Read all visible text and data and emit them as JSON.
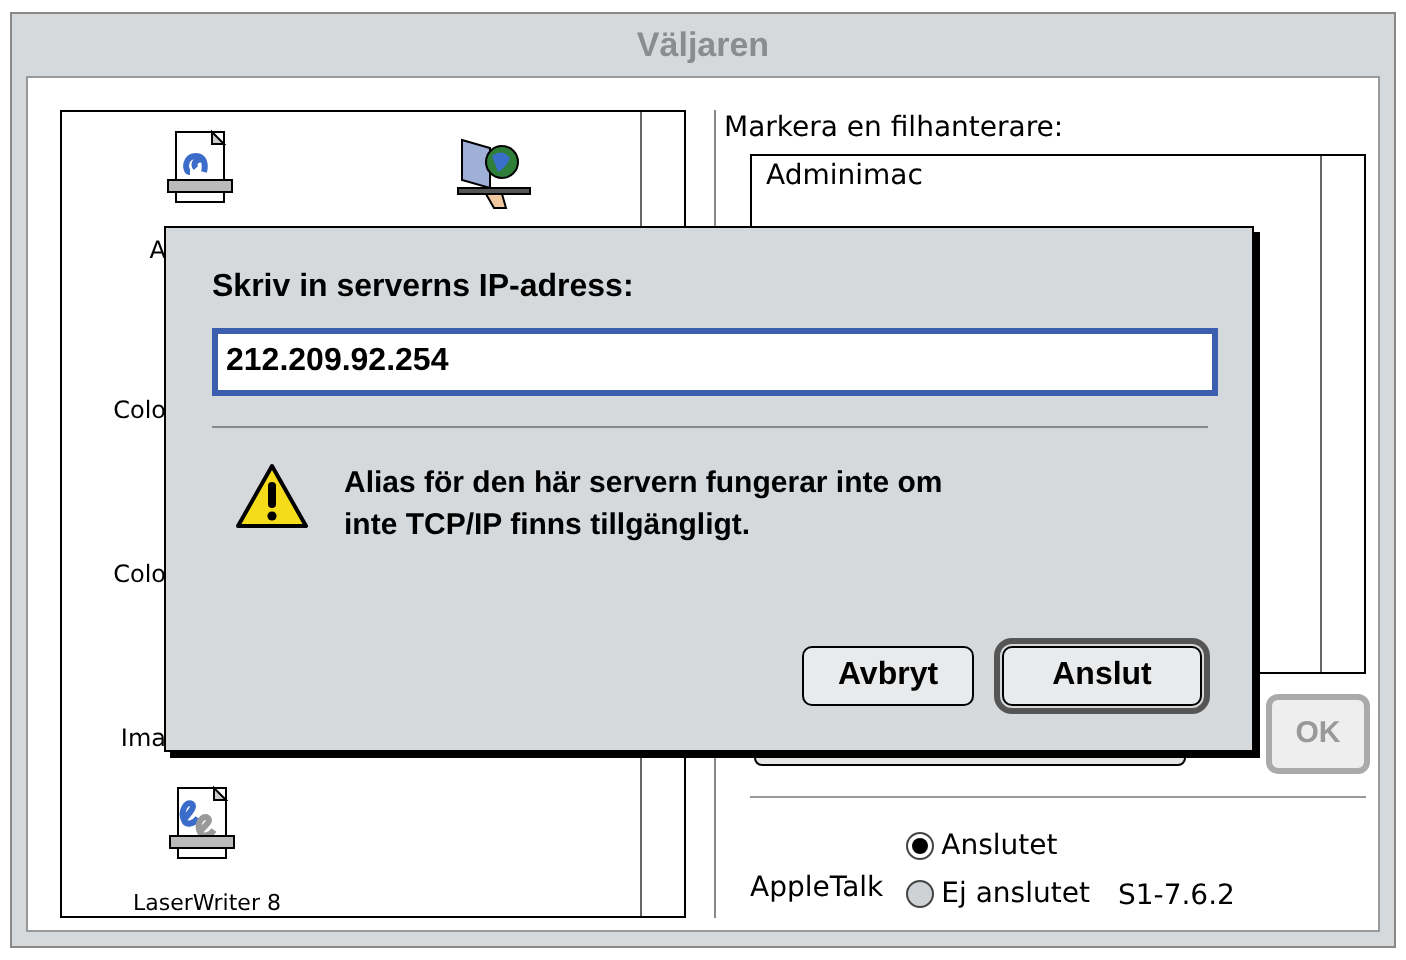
{
  "window": {
    "title": "Väljaren"
  },
  "devices": [
    {
      "label": "A",
      "kind": "printer"
    },
    {
      "kind": "server"
    },
    {
      "label": "Colo",
      "kind": "partial"
    },
    {
      "label": "Colo",
      "kind": "partial"
    },
    {
      "label": "Ima",
      "kind": "partial"
    },
    {
      "label": "LaserWriter 8",
      "kind": "laser"
    }
  ],
  "server_list": {
    "label": "Markera en filhanterare:",
    "items": [
      {
        "text": "Adminimac",
        "selected": false
      }
    ]
  },
  "ok_button": {
    "label": "OK",
    "disabled": true
  },
  "appletalk": {
    "label": "AppleTalk",
    "options": [
      {
        "label": "Anslutet",
        "selected": true
      },
      {
        "label": "Ej anslutet",
        "selected": false
      }
    ]
  },
  "version": "S1-7.6.2",
  "dialog": {
    "prompt": "Skriv in serverns IP-adress:",
    "value": "212.209.92.254",
    "warning": "Alias för den här servern fungerar inte om inte TCP/IP finns tillgängligt.",
    "buttons": [
      {
        "label": "Avbryt",
        "default": false
      },
      {
        "label": "Anslut",
        "default": true
      }
    ]
  }
}
